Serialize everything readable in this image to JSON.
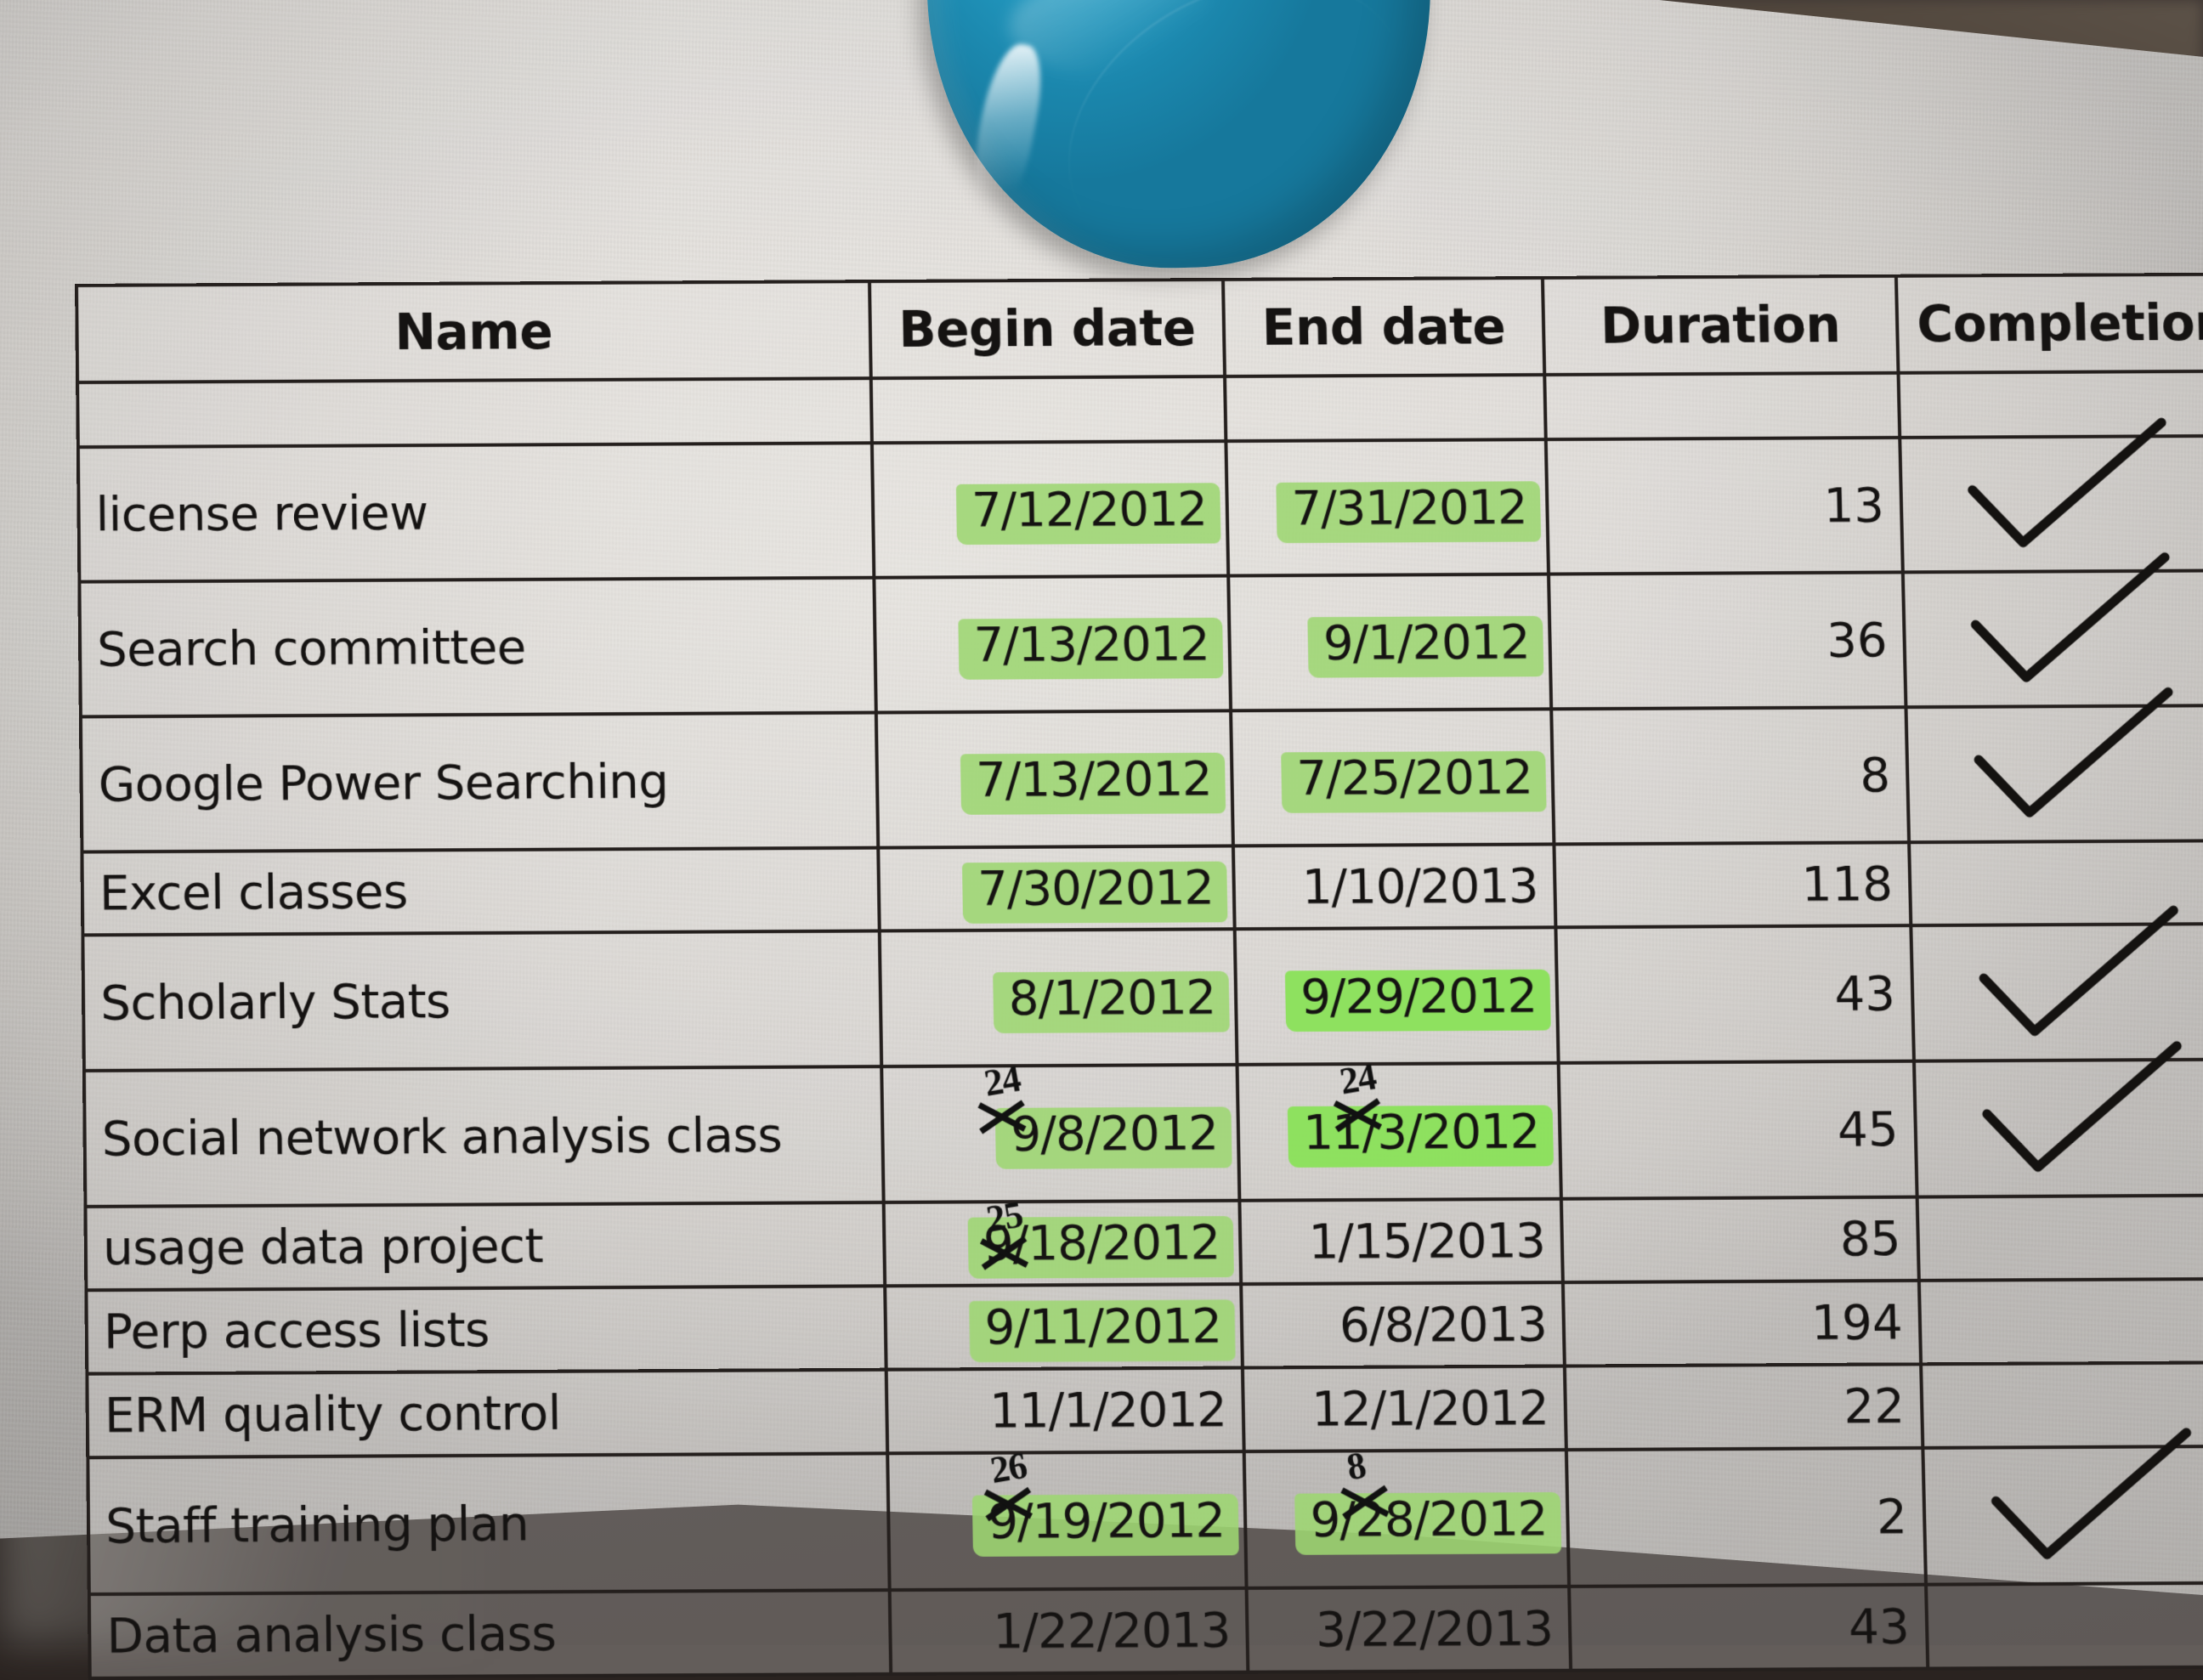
{
  "scene": {
    "object_name": "blue-disc",
    "object_color": "#1b87ad",
    "paper_color": "#e3e0db",
    "desk_color": "#2e2724",
    "highlighter_color": "#7fd243",
    "ink_color": "#151312"
  },
  "table": {
    "columns": [
      {
        "key": "name",
        "label": "Name"
      },
      {
        "key": "begin",
        "label": "Begin date"
      },
      {
        "key": "end",
        "label": "End date"
      },
      {
        "key": "duration",
        "label": "Duration"
      },
      {
        "key": "completion",
        "label": "Completion"
      }
    ],
    "rows": [
      {
        "name": "license review",
        "begin": "7/12/2012",
        "end": "7/31/2012",
        "duration": "13",
        "completion": "check",
        "begin_highlight": true,
        "end_highlight": true
      },
      {
        "name": "Search committee",
        "begin": "7/13/2012",
        "end": "9/1/2012",
        "duration": "36",
        "completion": "check",
        "begin_highlight": true,
        "end_highlight": true
      },
      {
        "name": "Google Power Searching",
        "begin": "7/13/2012",
        "end": "7/25/2012",
        "duration": "8",
        "completion": "check",
        "begin_highlight": true,
        "end_highlight": true
      },
      {
        "name": "Excel classes",
        "begin": "7/30/2012",
        "end": "1/10/2013",
        "duration": "118",
        "completion": "",
        "begin_highlight": true,
        "end_highlight": false
      },
      {
        "name": "Scholarly Stats",
        "begin": "8/1/2012",
        "end": "9/29/2012",
        "duration": "43",
        "completion": "check",
        "begin_highlight": true,
        "end_highlight": true
      },
      {
        "name": "Social network analysis class",
        "begin": "9/8/2012",
        "end": "11/3/2012",
        "duration": "45",
        "completion": "check",
        "begin_highlight": true,
        "end_highlight": true,
        "begin_annotation": "24",
        "end_annotation": "24"
      },
      {
        "name": "usage data project",
        "begin": "9/18/2012",
        "end": "1/15/2013",
        "duration": "85",
        "completion": "",
        "begin_highlight": true,
        "end_highlight": false,
        "begin_annotation": "25"
      },
      {
        "name": "Perp access lists",
        "begin": "9/11/2012",
        "end": "6/8/2013",
        "duration": "194",
        "completion": "",
        "begin_highlight": true,
        "end_highlight": false
      },
      {
        "name": "ERM quality control",
        "begin": "11/1/2012",
        "end": "12/1/2012",
        "duration": "22",
        "completion": "",
        "begin_highlight": false,
        "end_highlight": false
      },
      {
        "name": "Staff training plan",
        "begin": "9/19/2012",
        "end": "9/28/2012",
        "duration": "2",
        "completion": "check",
        "begin_highlight": true,
        "end_highlight": true,
        "begin_annotation": "26",
        "end_annotation": "8"
      },
      {
        "name": "Data analysis class",
        "begin": "1/22/2013",
        "end": "3/22/2013",
        "duration": "43",
        "completion": "",
        "begin_highlight": false,
        "end_highlight": false
      }
    ]
  }
}
